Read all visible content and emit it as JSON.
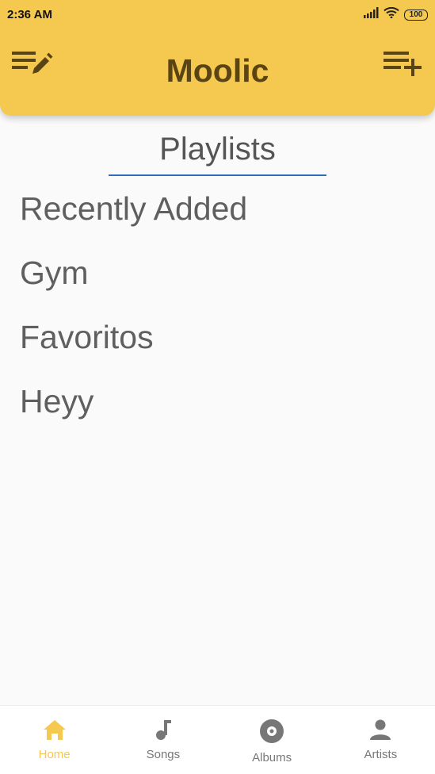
{
  "status_bar": {
    "time": "2:36 AM",
    "battery": "100",
    "icons": [
      "signal-icon",
      "wifi-icon",
      "battery-icon"
    ]
  },
  "header": {
    "title": "Moolic",
    "left_icon": "edit-list-icon",
    "right_icon": "playlist-add-icon"
  },
  "main": {
    "section_title": "Playlists",
    "playlists": [
      "Recently Added",
      "Gym",
      "Favoritos",
      "Heyy"
    ]
  },
  "bottom_nav": {
    "items": [
      {
        "label": "Home",
        "icon": "home-icon",
        "active": true
      },
      {
        "label": "Songs",
        "icon": "music-note-icon",
        "active": false
      },
      {
        "label": "Albums",
        "icon": "album-icon",
        "active": false
      },
      {
        "label": "Artists",
        "icon": "person-icon",
        "active": false
      }
    ]
  },
  "colors": {
    "accent": "#f5c94f",
    "title_text": "#5a4413",
    "tab_underline": "#2f6db5",
    "list_text": "#5f5f5f",
    "nav_inactive": "#777777"
  }
}
